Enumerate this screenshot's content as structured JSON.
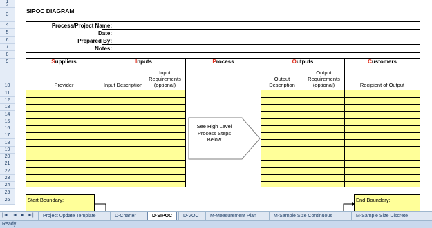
{
  "sheet": {
    "title": "SIPOC DIAGRAM",
    "rows": [
      "1",
      "2",
      "3",
      "4",
      "5",
      "6",
      "7",
      "8",
      "9",
      "10",
      "11",
      "12",
      "13",
      "14",
      "15",
      "16",
      "17",
      "18",
      "19",
      "20",
      "21",
      "22",
      "23",
      "24",
      "25",
      "26"
    ],
    "info_labels": [
      "Process/Project Name:",
      "Date:",
      "Prepared By:",
      "Notes:"
    ],
    "sections": {
      "suppliers": {
        "cap": "S",
        "rest": "uppliers"
      },
      "inputs": {
        "cap": "I",
        "rest": "nputs"
      },
      "process": {
        "cap": "P",
        "rest": "rocess"
      },
      "outputs": {
        "cap": "O",
        "rest": "utputs"
      },
      "customers": {
        "cap": "C",
        "rest": "ustomers"
      }
    },
    "columns": {
      "provider": "Provider",
      "input_description": "Input Description",
      "input_requirements": "Input Requirements (optional)",
      "output_description": "Output Description",
      "output_requirements": "Output Requirements (optional)",
      "recipient": "Recipient of Output"
    },
    "process_box": "See High Level Process Steps Below",
    "start_boundary": "Start Boundary:",
    "end_boundary": "End Boundary:",
    "accent_color": "#e0301e",
    "fill_color": "#ffff99"
  },
  "tabs": {
    "nav": [
      "|◄",
      "◄",
      "►",
      "►|"
    ],
    "items": [
      "Project Update Template",
      "D-Charter",
      "D-SIPOC",
      "D-VOC",
      "M-Measurement Plan",
      "M-Sample Size Continuous",
      "M-Sample Size Discrete"
    ],
    "active": "D-SIPOC"
  },
  "status": {
    "text": "Ready"
  }
}
